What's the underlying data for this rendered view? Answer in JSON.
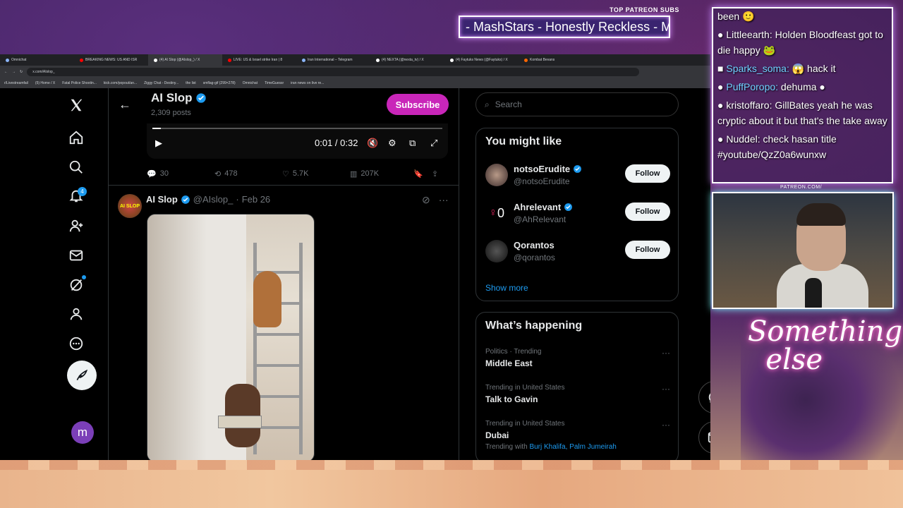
{
  "overlay": {
    "patreon_label": "TOP PATREON SUBS",
    "patreon_scroll": "- MashStars - Honestly Reckless - Mc",
    "patreon_small": "PATREON.COM/",
    "script_text": "Something else"
  },
  "browser": {
    "tabs": [
      {
        "label": "Omnichat"
      },
      {
        "label": "BREAKING NEWS: US AND ISR"
      },
      {
        "label": "(4) AI Slop (@AIslop_) / X"
      },
      {
        "label": "LIVE: US & Israel strike Iran | 8"
      },
      {
        "label": "Iran International – Telegram"
      },
      {
        "label": "(4) NEXTA (@nexta_tv) / X"
      },
      {
        "label": "(4) Faytuks News (@Faytuks) / X"
      },
      {
        "label": "Kombat Bevans"
      }
    ],
    "url": "x.com/AIslop_",
    "bookmarks": [
      "r/Livestreamfail",
      "(5) Home / X",
      "Fatal Police Shootin...",
      "kick.com/popout/an...",
      "Ziggy Chat - Destiny...",
      "the list",
      "smflag-gif (299×278)",
      "Omnichat",
      "TimeGuessr",
      "iran news on live re..."
    ]
  },
  "x": {
    "nav": {
      "notif_count": "4",
      "avatar_letter": "m"
    },
    "header": {
      "name": "AI Slop",
      "posts": "2,309 posts",
      "subscribe": "Subscribe"
    },
    "video": {
      "time": "0:01 / 0:32"
    },
    "actions": {
      "replies": "30",
      "reposts": "478",
      "likes": "5.7K",
      "views": "207K"
    },
    "post": {
      "avatar_text": "AI SLOP",
      "name": "AI Slop",
      "handle": "@AIslop_",
      "sep": "·",
      "date": "Feb 26"
    },
    "search_placeholder": "Search",
    "you_might_like": {
      "title": "You might like",
      "users": [
        {
          "name": "notsoErudite",
          "handle": "@notsoErudite",
          "btn": "Follow"
        },
        {
          "name": "Ahrelevant",
          "handle": "@AhRelevant",
          "btn": "Follow",
          "avatar_text": "0"
        },
        {
          "name": "Qorantos",
          "handle": "@qorantos",
          "btn": "Follow"
        }
      ],
      "show_more": "Show more"
    },
    "happening": {
      "title": "What’s happening",
      "trends": [
        {
          "context": "Politics · Trending",
          "topic": "Middle East"
        },
        {
          "context": "Trending in United States",
          "topic": "Talk to Gavin"
        },
        {
          "context": "Trending in United States",
          "topic": "Dubai",
          "with_label": "Trending with",
          "with": "Burj Khalifa, Palm Jumeirah"
        }
      ]
    }
  },
  "chat": {
    "messages": [
      {
        "user": "",
        "text": "been"
      },
      {
        "user": "Littleearth:",
        "text": " Holden Bloodfeast got to die happy"
      },
      {
        "user": "Sparks_soma:",
        "text": " hack it"
      },
      {
        "user": "PuffPoropo:",
        "text": " dehuma"
      },
      {
        "user": "kristoffaro:",
        "text": " GillBates yeah he was cryptic about it but that's the take away"
      },
      {
        "user": "Nuddel:",
        "text": " check hasan title #youtube/QzZ0a6wunxw"
      }
    ]
  }
}
